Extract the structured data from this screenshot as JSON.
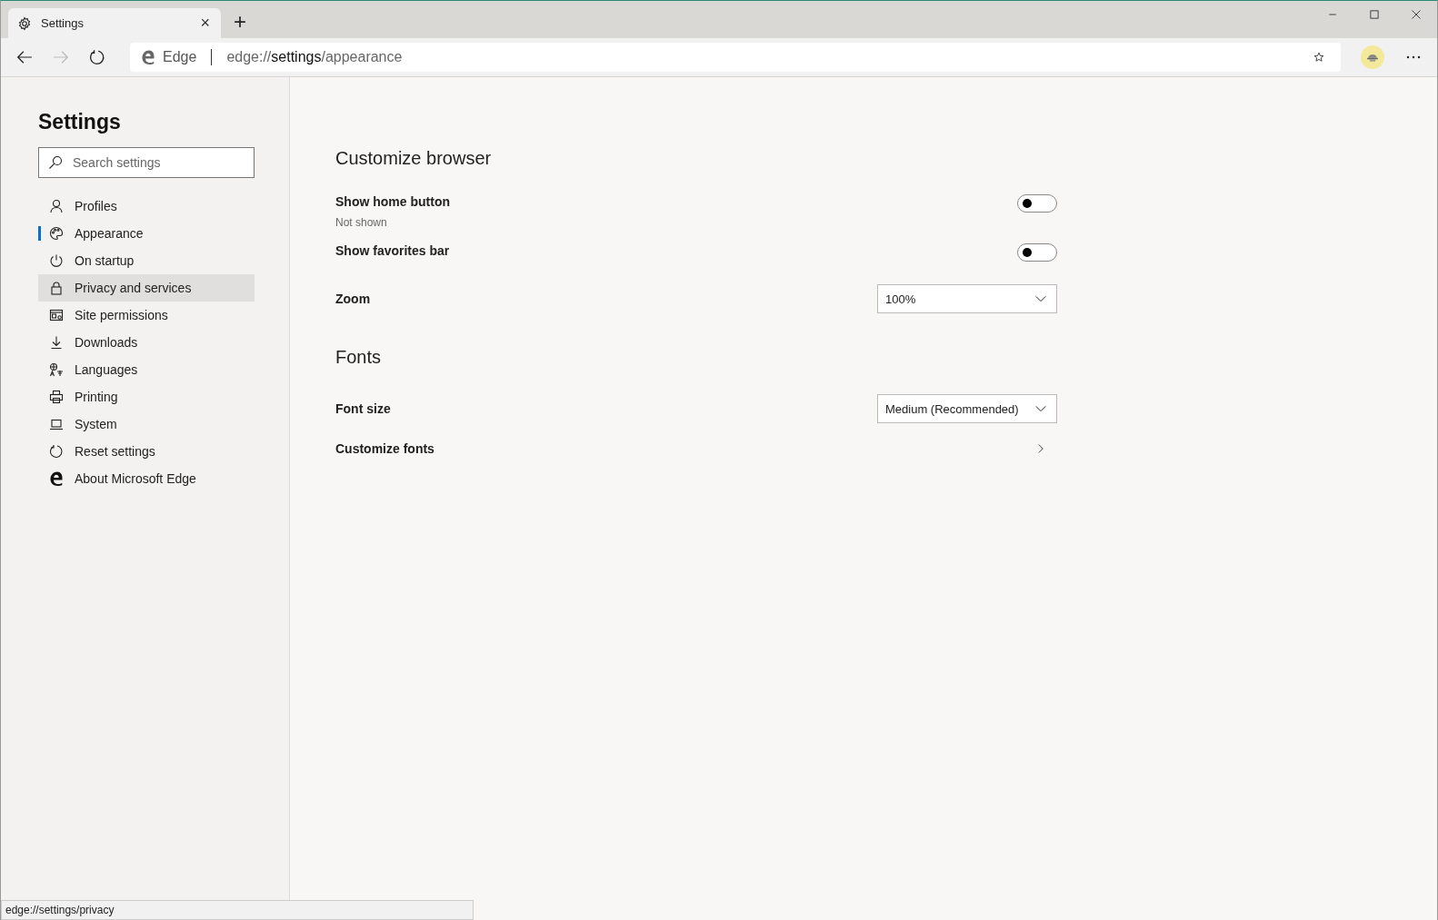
{
  "tab": {
    "title": "Settings",
    "close": "×",
    "selected": true
  },
  "new_tab": "+",
  "address_bar": {
    "site_label": "Edge",
    "url_scheme": "edge://",
    "url_host": "settings",
    "url_path": "/appearance"
  },
  "sidebar": {
    "title": "Settings",
    "search": {
      "placeholder": "Search settings"
    },
    "items": [
      {
        "label": "Profiles",
        "kind": "person",
        "selected": false,
        "hovered": false
      },
      {
        "label": "Appearance",
        "kind": "palette",
        "selected": true,
        "hovered": false
      },
      {
        "label": "On startup",
        "kind": "power",
        "selected": false,
        "hovered": false
      },
      {
        "label": "Privacy and services",
        "kind": "lock",
        "selected": false,
        "hovered": true
      },
      {
        "label": "Site permissions",
        "kind": "permissions",
        "selected": false,
        "hovered": false
      },
      {
        "label": "Downloads",
        "kind": "download",
        "selected": false,
        "hovered": false
      },
      {
        "label": "Languages",
        "kind": "language",
        "selected": false,
        "hovered": false
      },
      {
        "label": "Printing",
        "kind": "printer",
        "selected": false,
        "hovered": false
      },
      {
        "label": "System",
        "kind": "laptop",
        "selected": false,
        "hovered": false
      },
      {
        "label": "Reset settings",
        "kind": "reset",
        "selected": false,
        "hovered": false
      },
      {
        "label": "About Microsoft Edge",
        "kind": "edge",
        "selected": false,
        "hovered": false
      }
    ]
  },
  "sections": [
    {
      "title": "Customize browser",
      "rows": [
        {
          "kind": "toggle",
          "label": "Show home button",
          "description": "Not shown",
          "on": false
        },
        {
          "kind": "toggle",
          "label": "Show favorites bar",
          "on": false
        },
        {
          "kind": "dropdown",
          "label": "Zoom",
          "value": "100%"
        }
      ]
    },
    {
      "title": "Fonts",
      "rows": [
        {
          "kind": "dropdown",
          "label": "Font size",
          "value": "Medium (Recommended)"
        },
        {
          "kind": "link",
          "label": "Customize fonts"
        }
      ]
    }
  ],
  "status_bar": {
    "url": "edge://settings/privacy"
  }
}
